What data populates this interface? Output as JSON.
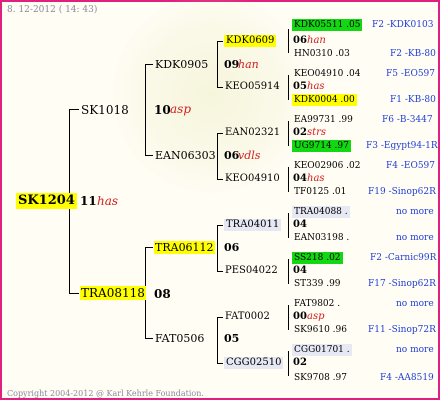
{
  "header": {
    "timestamp": "8. 12-2012 ( 14: 43)"
  },
  "footer": {
    "copyright": "Copyright 2004-2012 @ Karl Kehrle Foundation."
  },
  "root": {
    "id": "SK1204",
    "year": "11",
    "breeder": "has"
  },
  "gen1": {
    "father": {
      "id": "SK1018",
      "year": "10",
      "breeder": "asp"
    },
    "mother": {
      "id": "TRA08118",
      "year": "08"
    }
  },
  "gen2": [
    {
      "id": "KDK0905",
      "year": "09",
      "breeder": "han"
    },
    {
      "id": "EAN06303",
      "year": "06",
      "breeder": "vdls"
    },
    {
      "id": "TRA06112",
      "year": "06"
    },
    {
      "id": "FAT0506",
      "year": "05"
    }
  ],
  "gen3": [
    {
      "id": "KDK0609",
      "year": "06",
      "breeder": "han"
    },
    {
      "id": "KEO05914",
      "year": "05",
      "breeder": "has"
    },
    {
      "id": "EAN02321",
      "year": "02",
      "breeder": "strs"
    },
    {
      "id": "KEO04910",
      "year": "04",
      "breeder": "has"
    },
    {
      "id": "TRA04011",
      "year": "04"
    },
    {
      "id": "PES04022",
      "year": "04"
    },
    {
      "id": "FAT0002",
      "year": "00",
      "breeder": "asp"
    },
    {
      "id": "CGG02510",
      "year": "02"
    }
  ],
  "gen4": [
    {
      "id": "KDK05511 .05",
      "ref": "F2 -KDK0103"
    },
    {
      "id": "HN0310 .03",
      "ref": "F2 -KB-80"
    },
    {
      "id": "KEO04910 .04",
      "ref": "F5 -EO597"
    },
    {
      "id": "KDK0004 .00",
      "ref": "F1 -KB-80"
    },
    {
      "id": "EA99731 .99",
      "ref": "F6 -B-3447"
    },
    {
      "id": "UG9714 .97",
      "ref": "F3 -Egypt94-1R"
    },
    {
      "id": "KEO02906 .02",
      "ref": "F4 -EO597"
    },
    {
      "id": "TF0125 .01",
      "ref": "F19 -Sinop62R"
    },
    {
      "id": "TRA04088 .",
      "ref": "no more"
    },
    {
      "id": "EAN03198 .",
      "ref": "no more"
    },
    {
      "id": "SS218 .02",
      "ref": "F2 -Carnic99R"
    },
    {
      "id": "ST339 .99",
      "ref": "F17 -Sinop62R"
    },
    {
      "id": "FAT9802 .",
      "ref": "no more"
    },
    {
      "id": "SK9610 .96",
      "ref": "F11 -Sinop72R"
    },
    {
      "id": "CGG01701 .",
      "ref": "no more"
    },
    {
      "id": "SK9708 .97",
      "ref": "F4 -AA8519"
    }
  ]
}
